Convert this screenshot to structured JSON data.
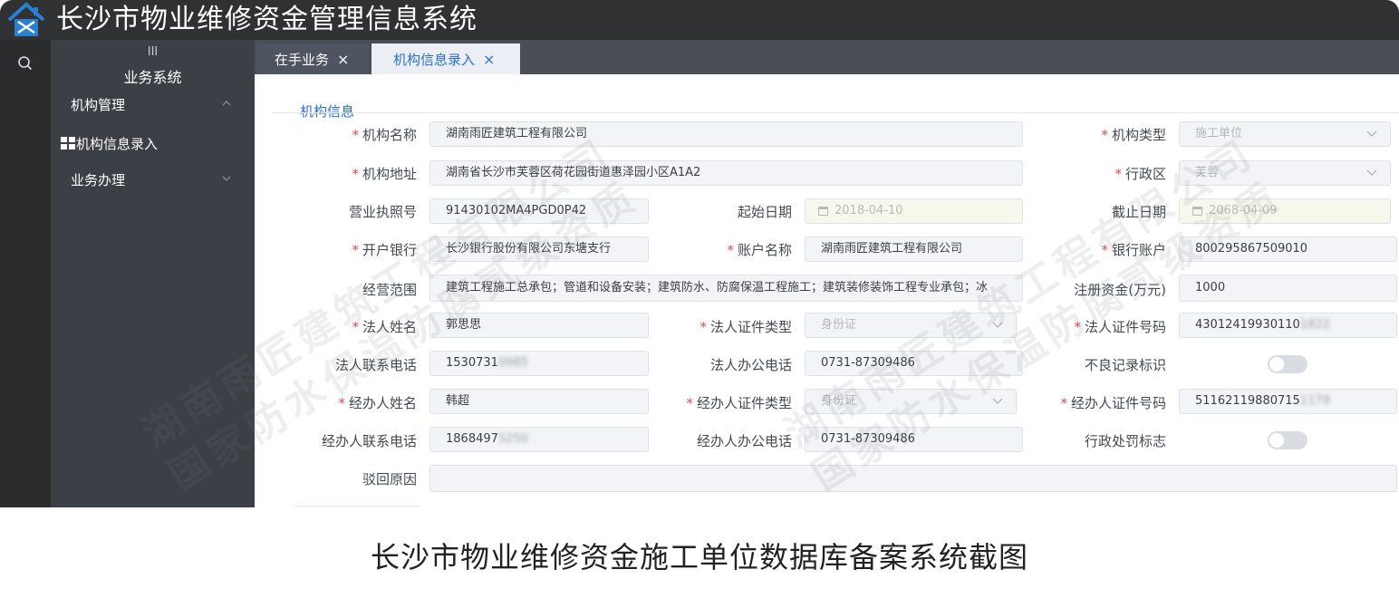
{
  "app": {
    "title": "长沙市物业维修资金管理信息系统"
  },
  "sidebar": {
    "collapse_glyph": "III",
    "system_title": "业务系统",
    "menus": [
      {
        "label": "机构管理",
        "expanded": true,
        "icon": "chevron-up-icon"
      },
      {
        "label": "机构信息录入",
        "icon": "grid-icon"
      },
      {
        "label": "业务办理",
        "expanded": false,
        "icon": "chevron-down-icon"
      }
    ]
  },
  "tabs": [
    {
      "label": "在手业务",
      "close": "×",
      "active": false
    },
    {
      "label": "机构信息录入",
      "close": "×",
      "active": true
    }
  ],
  "section": {
    "title": "机构信息"
  },
  "form": {
    "org_name": {
      "label": "机构名称",
      "value": "湖南雨匠建筑工程有限公司"
    },
    "org_type": {
      "label": "机构类型",
      "value": "施工单位"
    },
    "org_address": {
      "label": "机构地址",
      "value": "湖南省长沙市芙蓉区荷花园街道惠泽园小区A1A2"
    },
    "district": {
      "label": "行政区",
      "value": "芙蓉"
    },
    "license_no": {
      "label": "营业执照号",
      "value": "91430102MA4PGD0P42"
    },
    "start_date": {
      "label": "起始日期",
      "value": "2018-04-10"
    },
    "end_date": {
      "label": "截止日期",
      "value": "2068-04-09"
    },
    "bank": {
      "label": "开户银行",
      "value": "长沙银行股份有限公司东塘支行"
    },
    "account_name": {
      "label": "账户名称",
      "value": "湖南雨匠建筑工程有限公司"
    },
    "bank_account": {
      "label": "银行账户",
      "value": "800295867509010"
    },
    "business_scope": {
      "label": "经营范围",
      "value": "建筑工程施工总承包；管道和设备安装；建筑防水、防腐保温工程施工；建筑装修装饰工程专业承包；冰"
    },
    "reg_capital": {
      "label": "注册资金(万元)",
      "value": "1000"
    },
    "legal_name": {
      "label": "法人姓名",
      "value": "郭思思"
    },
    "legal_id_type": {
      "label": "法人证件类型",
      "value": "身份证"
    },
    "legal_id_no": {
      "label": "法人证件号码",
      "value": "43012419930110",
      "value_blur": "1822"
    },
    "legal_phone": {
      "label": "法人联系电话",
      "value": "1530731",
      "value_blur": "0985"
    },
    "legal_office_phone": {
      "label": "法人办公电话",
      "value": "0731-87309486"
    },
    "bad_record": {
      "label": "不良记录标识",
      "on": false
    },
    "agent_name": {
      "label": "经办人姓名",
      "value": "韩超"
    },
    "agent_id_type": {
      "label": "经办人证件类型",
      "value": "身份证"
    },
    "agent_id_no": {
      "label": "经办人证件号码",
      "value": "51162119880715",
      "value_blur": "1179"
    },
    "agent_phone": {
      "label": "经办人联系电话",
      "value": "1868497",
      "value_blur": "5250"
    },
    "agent_office_phone": {
      "label": "经办人办公电话",
      "value": "0731-87309486"
    },
    "penalty": {
      "label": "行政处罚标志",
      "on": false
    },
    "reject_reason": {
      "label": "驳回原因",
      "value": ""
    }
  },
  "watermarks": [
    "湖南雨匠建筑工程有限公司",
    "国家防水保温防腐贰级资质"
  ],
  "caption": "长沙市物业维修资金施工单位数据库备案系统截图",
  "colors": {
    "titlebar": "#2f3133",
    "sidebar": "#3b4046",
    "accent": "#2c6fd4",
    "required": "#e34a4a"
  }
}
